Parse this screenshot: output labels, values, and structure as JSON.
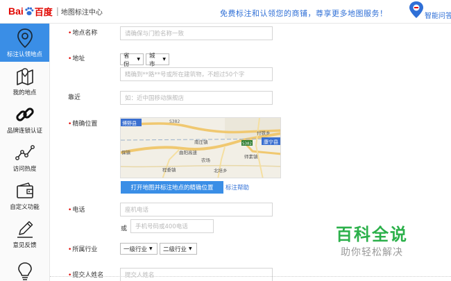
{
  "header": {
    "logo_bai": "Bai",
    "logo_du": "百度",
    "logo_sub": "地图标注中心",
    "slogan": "免费标注和认领您的商铺，尊享更多地图服务！",
    "right_text": "智能问答"
  },
  "sidebar": {
    "items": [
      {
        "label": "标注认领地点",
        "icon": "location-pin-icon"
      },
      {
        "label": "我的地点",
        "icon": "map-icon"
      },
      {
        "label": "品牌连锁认证",
        "icon": "chain-link-icon"
      },
      {
        "label": "访问热度",
        "icon": "line-chart-icon"
      },
      {
        "label": "自定义功能",
        "icon": "wallet-icon"
      },
      {
        "label": "意见反馈",
        "icon": "pencil-icon"
      },
      {
        "label": "",
        "icon": "lightbulb-icon"
      }
    ],
    "active_color": "#3a8ee6"
  },
  "form": {
    "name_label": "地点名称",
    "name_placeholder": "请确保与门脸名称一致",
    "address_label": "地址",
    "province": "省份",
    "city": "城市",
    "address_placeholder": "精确到**路**号或所在建筑物，不超过50个字",
    "near_label": "靠近",
    "near_placeholder": "如：近中国移动旗舰店",
    "position_label": "精确位置",
    "map_labels": [
      "博野县",
      "S382",
      "付铁乡",
      "康宁县",
      "南庄镇",
      "S382",
      "曲阳高速",
      "农场",
      "师素镇",
      "程委镇",
      "北培乡",
      "保镇"
    ],
    "map_button": "打开地图并标注地点的精确位置",
    "map_help": "标注帮助",
    "phone_label": "电话",
    "landline_placeholder": "座机电话",
    "or_text": "或",
    "mobile_placeholder": "手机号码或400电话",
    "industry_label": "所属行业",
    "industry_level1": "一级行业",
    "industry_level2": "二级行业",
    "submitter_label": "提交人姓名",
    "submitter_placeholder": "提交人姓名"
  },
  "watermark": {
    "title": "百科全说",
    "subtitle": "助你轻松解决"
  },
  "colors": {
    "brand_red": "#e10601",
    "accent_blue": "#3a8ee6",
    "link_blue": "#2f6fd6",
    "watermark_green": "#2bb04a"
  }
}
